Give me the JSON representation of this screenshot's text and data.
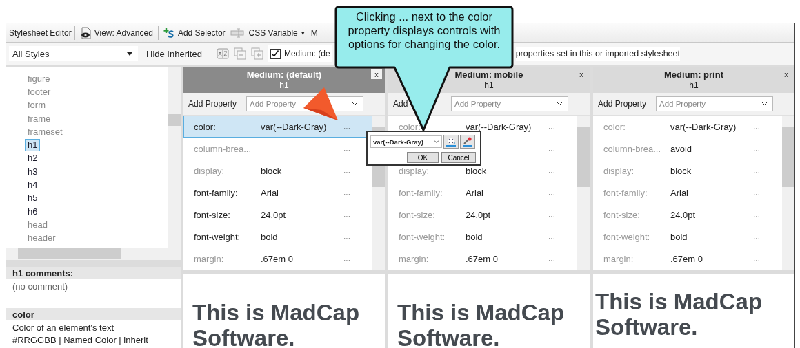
{
  "toolbar": {
    "title": "Stylesheet Editor",
    "view_button": "View: Advanced",
    "add_selector_button": "Add Selector",
    "css_variable_button": "CSS Variable",
    "caret": "▾",
    "cut_item": "M"
  },
  "filter_bar": {
    "style_dropdown": "All Styles",
    "hide_inherited": "Hide Inherited",
    "medium_checkbox": {
      "label": "Medium: (de",
      "checked": true
    },
    "hint": "properties set in this or imported stylesheet"
  },
  "selector_list": {
    "items": [
      {
        "label": "figure",
        "used": false,
        "selected": false
      },
      {
        "label": "footer",
        "used": false,
        "selected": false
      },
      {
        "label": "form",
        "used": false,
        "selected": false
      },
      {
        "label": "frame",
        "used": false,
        "selected": false
      },
      {
        "label": "frameset",
        "used": false,
        "selected": false
      },
      {
        "label": "h1",
        "used": true,
        "selected": true
      },
      {
        "label": "h2",
        "used": true,
        "selected": false
      },
      {
        "label": "h3",
        "used": true,
        "selected": false
      },
      {
        "label": "h4",
        "used": true,
        "selected": false
      },
      {
        "label": "h5",
        "used": true,
        "selected": false
      },
      {
        "label": "h6",
        "used": true,
        "selected": false
      },
      {
        "label": "head",
        "used": false,
        "selected": false
      },
      {
        "label": "header",
        "used": false,
        "selected": false
      }
    ]
  },
  "comments": {
    "header": "h1 comments:",
    "text": "(no comment)"
  },
  "description": {
    "header": "color",
    "lines": [
      "Color of an element's text",
      "#RRGGBB | Named Color | inherit"
    ]
  },
  "panels": [
    {
      "medium": "Medium: (default)",
      "selector": "h1",
      "active": true,
      "close": "x",
      "add_property_label": "Add Property",
      "add_property_placeholder": "Add Property",
      "properties": [
        {
          "name": "color:",
          "value": "var(--Dark-Gray)",
          "set": true,
          "selected": true,
          "menu": "..."
        },
        {
          "name": "column-brea...",
          "set": false,
          "selected": false,
          "menu": "..."
        },
        {
          "name": "display:",
          "value": "block",
          "set": false,
          "selected": false,
          "menu": "..."
        },
        {
          "name": "font-family:",
          "value": "Arial",
          "set": true,
          "selected": false,
          "menu": "..."
        },
        {
          "name": "font-size:",
          "value": "24.0pt",
          "set": true,
          "selected": false,
          "menu": "..."
        },
        {
          "name": "font-weight:",
          "value": "bold",
          "set": true,
          "selected": false,
          "menu": "..."
        },
        {
          "name": "margin:",
          "value": ".67em 0",
          "set": false,
          "selected": false,
          "menu": "..."
        }
      ],
      "preview": "This is MadCap Software."
    },
    {
      "medium": "Medium: mobile",
      "selector": "h1",
      "active": false,
      "close": "x",
      "add_property_label": "Add",
      "add_property_placeholder": "Add Property",
      "properties": [
        {
          "name": "color:",
          "value": "var(--Dark-Gray)",
          "set": false,
          "selected": false,
          "menu": "..."
        },
        {
          "selected": false,
          "menu": "..."
        },
        {
          "name": "display:",
          "value": "block",
          "set": false,
          "selected": false,
          "menu": "..."
        },
        {
          "name": "font-family:",
          "value": "Arial",
          "set": false,
          "selected": false,
          "menu": "..."
        },
        {
          "name": "font-size:",
          "value": "24.0pt",
          "set": false,
          "selected": false,
          "menu": "..."
        },
        {
          "name": "font-weight:",
          "value": "bold",
          "set": false,
          "selected": false,
          "menu": "..."
        },
        {
          "name": "margin:",
          "value": ".67em 0",
          "set": false,
          "selected": false,
          "menu": "..."
        }
      ],
      "preview": "This is MadCap Software."
    },
    {
      "medium": "Medium: print",
      "selector": "h1",
      "active": false,
      "close": "x",
      "add_property_label": "Add Property",
      "add_property_placeholder": "Add Property",
      "properties": [
        {
          "name": "color:",
          "value": "var(--Dark-Gray)",
          "set": false,
          "selected": false,
          "menu": "..."
        },
        {
          "name": "column-brea...",
          "value": "avoid",
          "set": false,
          "selected": false,
          "menu": "..."
        },
        {
          "name": "display:",
          "value": "block",
          "set": false,
          "selected": false,
          "menu": "..."
        },
        {
          "name": "font-family:",
          "value": "Arial",
          "set": false,
          "selected": false,
          "menu": "..."
        },
        {
          "name": "font-size:",
          "value": "24.0pt",
          "set": false,
          "selected": false,
          "menu": "..."
        },
        {
          "name": "font-weight:",
          "value": "bold",
          "set": false,
          "selected": false,
          "menu": "..."
        },
        {
          "name": "margin:",
          "value": ".67em 0",
          "set": false,
          "selected": false,
          "menu": "..."
        }
      ],
      "preview": "This is MadCap Software."
    }
  ],
  "color_popup": {
    "value": "var(--Dark-Gray)",
    "ok_button": "OK",
    "cancel_button": "Cancel"
  },
  "callout": {
    "text": "Clicking ... next to the color property displays controls with options for changing the color."
  }
}
